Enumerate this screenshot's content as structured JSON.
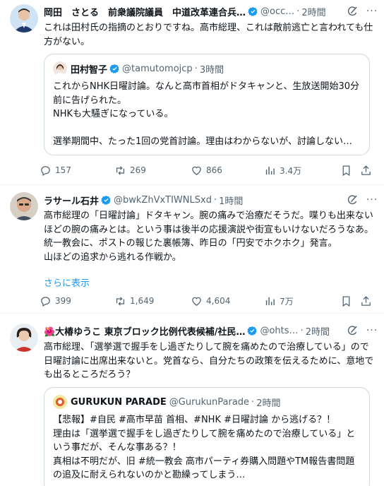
{
  "tweets": [
    {
      "name": "岡田　さとる　前衆議院議員　中道改革連合兵…",
      "handle": "@occ…",
      "time": "2時間",
      "text": "これは田村氏の指摘のとおりですね。高市総理、これは敵前逃亡と言われても仕方がない。",
      "quote": {
        "name": "田村智子",
        "handle": "@tamutomojcp",
        "time": "3時間",
        "text": "これからNHK日曜討論。なんと高市首相がドタキャンと、生放送開始30分前に告げられた。\nNHKも大騒ぎになっている。\n\n選挙期間中、たった1回の党首討論。理由はわからないが、討論しない…"
      },
      "stats": {
        "replies": "157",
        "retweets": "269",
        "likes": "866",
        "views": "3.4万"
      }
    },
    {
      "name": "ラサール石井",
      "handle": "@bwkZhVxTIWNLSxd",
      "time": "1時間",
      "text": "高市総理の「日曜討論」ドタキャン。腕の痛みで治療だそうだ。喋りも出来ないほどの腕の痛みとは。という事は後半の応援演説や街宣もいけないだろうなあ。\n統一教会に、ポストの報じた裏帳簿、昨日の「円安でホクホク」発言。\n山ほどの追求から逃れる作戦か。",
      "show_more": "さらに表示",
      "stats": {
        "replies": "399",
        "retweets": "1,649",
        "likes": "4,604",
        "views": "7万"
      }
    },
    {
      "name": "🌺大椿ゆうこ 東京ブロック比例代表候補/社民…",
      "handle": "@ohts…",
      "time": "2時間",
      "text": "高市総理、「選挙選で握手をし過ぎたりして腕を痛めたので治療している」ので日曜討論に出席出来ないと。党首なら、自分たちの政策を伝えるために、意地でも出るところだろう？",
      "quote": {
        "name": "GURUKUN PARADE",
        "handle": "@GurukunParade",
        "time": "2時間",
        "text": "【悲報】#自民 #高市早苗 首相、#NHK #日曜討論 から逃げる？！\n理由は「選挙選で握手をし過ぎたりして腕を痛めたので治療している」という事だが、そんな事ある？！\n真相は不明だが、旧 #統一教会 高市パーティ券購入問題やTM報告書問題の追及に耐えられないのかと勘繰ってしまう…"
      }
    }
  ],
  "colors": {
    "accent": "#1d9bf0",
    "muted": "#536471",
    "border": "#cfd9de"
  }
}
